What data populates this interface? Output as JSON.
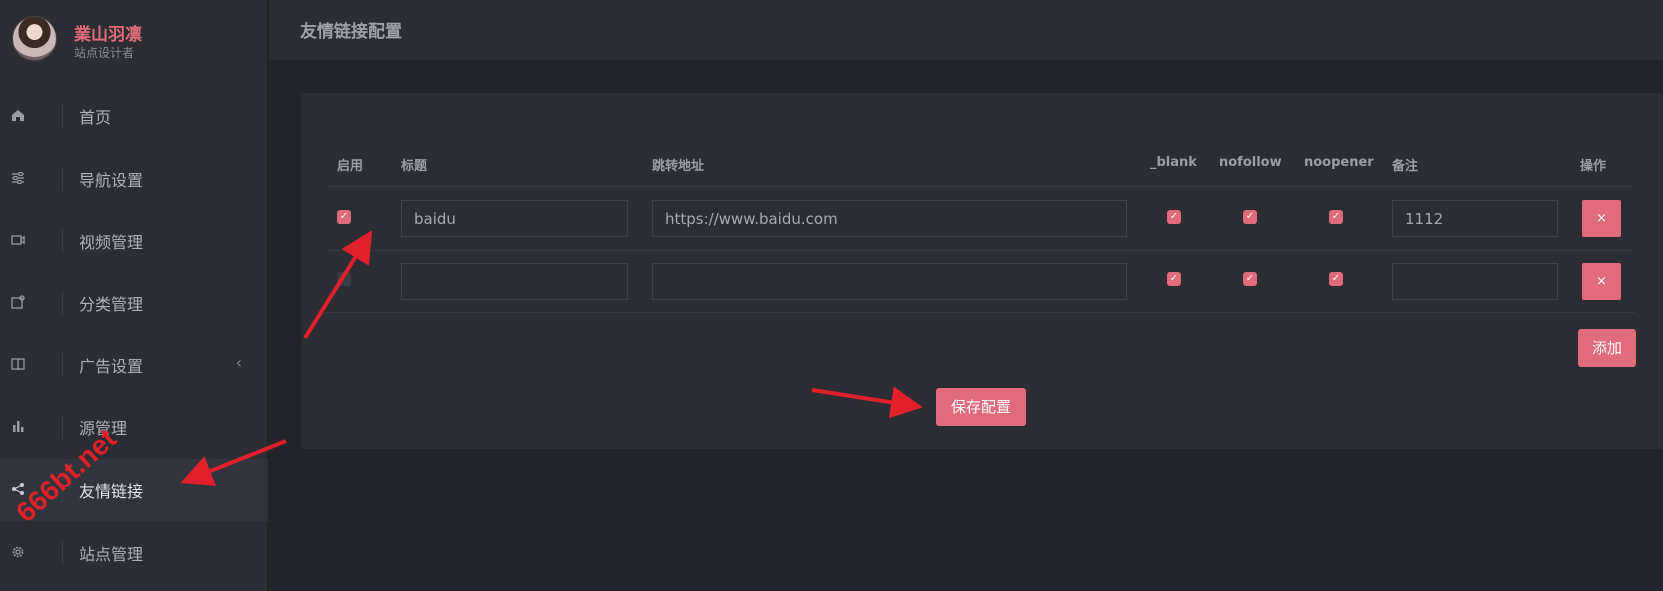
{
  "sidebar": {
    "profile": {
      "name": "業山羽凛",
      "role": "站点设计者"
    },
    "items": [
      {
        "label": "首页",
        "icon": "home-icon"
      },
      {
        "label": "导航设置",
        "icon": "sliders-icon"
      },
      {
        "label": "视频管理",
        "icon": "video-icon"
      },
      {
        "label": "分类管理",
        "icon": "category-icon"
      },
      {
        "label": "广告设置",
        "icon": "book-icon",
        "chevron": "‹"
      },
      {
        "label": "源管理",
        "icon": "bar-chart-icon"
      },
      {
        "label": "友情链接",
        "icon": "share-icon",
        "active": true
      },
      {
        "label": "站点管理",
        "icon": "gear-icon"
      }
    ]
  },
  "header": {
    "title": "友情链接配置"
  },
  "table": {
    "columns": [
      "启用",
      "标题",
      "跳转地址",
      "_blank",
      "nofollow",
      "noopener",
      "备注",
      "操作"
    ],
    "rows": [
      {
        "enabled": true,
        "title": "baidu",
        "url": "https://www.baidu.com",
        "blank": true,
        "nofollow": true,
        "noopener": true,
        "remark": "1112",
        "action": "×"
      },
      {
        "enabled": false,
        "title": "",
        "url": "",
        "blank": true,
        "nofollow": true,
        "noopener": true,
        "remark": "",
        "action": "×"
      }
    ]
  },
  "buttons": {
    "add": "添加",
    "save": "保存配置"
  },
  "watermark": "666bt.net",
  "colors": {
    "accent": "#e06b7a",
    "sidebar_bg": "#2b2d33",
    "page_bg": "#222429",
    "annotation": "#e0202a"
  }
}
